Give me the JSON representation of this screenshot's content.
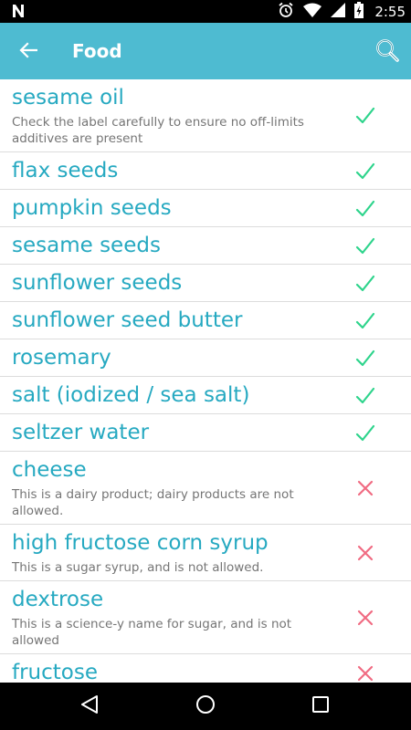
{
  "status_bar": {
    "time": "2:55",
    "notification_icon": "n-logo-icon",
    "icons": [
      "alarm-icon",
      "wifi-icon",
      "signal-icon",
      "battery-icon"
    ]
  },
  "app_bar": {
    "title": "Food",
    "back_icon": "arrow-back-icon",
    "search_icon": "search-icon",
    "background": "#4ebbd1"
  },
  "colors": {
    "item_name": "#26a9c1",
    "allowed": "#2ed48c",
    "not_allowed": "#f06b82"
  },
  "foods": [
    {
      "name": "sesame oil",
      "note": "Check the label carefully to ensure no off-limits additives are present",
      "allowed": true
    },
    {
      "name": "flax seeds",
      "note": "",
      "allowed": true
    },
    {
      "name": "pumpkin seeds",
      "note": "",
      "allowed": true
    },
    {
      "name": "sesame seeds",
      "note": "",
      "allowed": true
    },
    {
      "name": "sunflower seeds",
      "note": "",
      "allowed": true
    },
    {
      "name": "sunflower seed butter",
      "note": "",
      "allowed": true
    },
    {
      "name": "rosemary",
      "note": "",
      "allowed": true
    },
    {
      "name": "salt (iodized / sea salt)",
      "note": "",
      "allowed": true
    },
    {
      "name": "seltzer water",
      "note": "",
      "allowed": true
    },
    {
      "name": "cheese",
      "note": "This is a dairy product; dairy products are not allowed.",
      "allowed": false
    },
    {
      "name": "high fructose corn syrup",
      "note": "This is a sugar syrup, and is not allowed.",
      "allowed": false
    },
    {
      "name": "dextrose",
      "note": "This is a science-y name for sugar, and is not allowed",
      "allowed": false
    },
    {
      "name": "fructose",
      "note": "",
      "allowed": false
    }
  ],
  "nav_bar": {
    "icons": [
      "back-triangle-icon",
      "home-circle-icon",
      "recents-square-icon"
    ]
  }
}
